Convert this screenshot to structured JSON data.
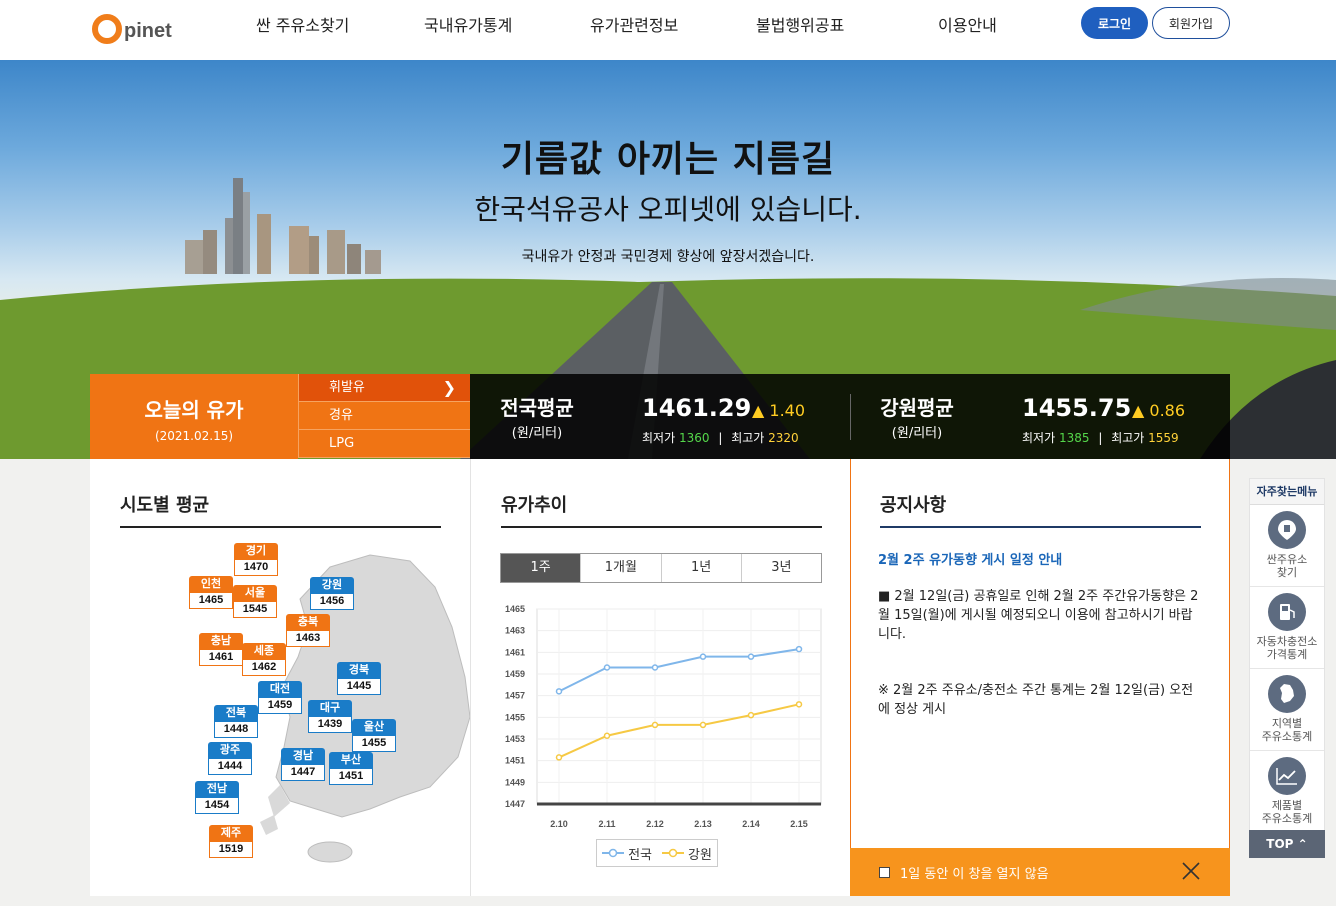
{
  "brand": {
    "logo_text": "pinet"
  },
  "nav": {
    "items": [
      "싼 주유소찾기",
      "국내유가통계",
      "유가관련정보",
      "불법행위공표",
      "이용안내"
    ],
    "login": "로그인",
    "join": "회원가입"
  },
  "hero": {
    "title": "기름값 아끼는 지름길",
    "subtitle": "한국석유공사 오피넷에 있습니다.",
    "desc": "국내유가 안정과 국민경제 향상에 앞장서겠습니다."
  },
  "today": {
    "title": "오늘의 유가",
    "date": "(2021.02.15)"
  },
  "fuel_tabs": [
    {
      "label": "휘발유",
      "active": true
    },
    {
      "label": "경유",
      "active": false
    },
    {
      "label": "LPG",
      "active": false
    }
  ],
  "price_summary": [
    {
      "name": "전국평균",
      "unit": "(원/리터)",
      "price": "1461.29",
      "delta": "▲ 1.40",
      "min_label": "최저가",
      "min": "1360",
      "max_label": "최고가",
      "max": "2320"
    },
    {
      "name": "강원평균",
      "unit": "(원/리터)",
      "price": "1455.75",
      "delta": "▲ 0.86",
      "min_label": "최저가",
      "min": "1385",
      "max_label": "최고가",
      "max": "1559"
    }
  ],
  "region_panel": {
    "title": "시도별 평균",
    "regions": [
      {
        "name": "경기",
        "value": "1470",
        "color": "orange"
      },
      {
        "name": "인천",
        "value": "1465",
        "color": "orange"
      },
      {
        "name": "서울",
        "value": "1545",
        "color": "orange"
      },
      {
        "name": "강원",
        "value": "1456",
        "color": "blue"
      },
      {
        "name": "충북",
        "value": "1463",
        "color": "orange"
      },
      {
        "name": "충남",
        "value": "1461",
        "color": "orange"
      },
      {
        "name": "세종",
        "value": "1462",
        "color": "orange"
      },
      {
        "name": "경북",
        "value": "1445",
        "color": "blue"
      },
      {
        "name": "대전",
        "value": "1459",
        "color": "blue"
      },
      {
        "name": "전북",
        "value": "1448",
        "color": "blue"
      },
      {
        "name": "대구",
        "value": "1439",
        "color": "blue"
      },
      {
        "name": "울산",
        "value": "1455",
        "color": "blue"
      },
      {
        "name": "광주",
        "value": "1444",
        "color": "blue"
      },
      {
        "name": "경남",
        "value": "1447",
        "color": "blue"
      },
      {
        "name": "부산",
        "value": "1451",
        "color": "blue"
      },
      {
        "name": "전남",
        "value": "1454",
        "color": "blue"
      },
      {
        "name": "제주",
        "value": "1519",
        "color": "orange"
      }
    ]
  },
  "trend_panel": {
    "title": "유가추이",
    "periods": [
      {
        "label": "1주",
        "active": true
      },
      {
        "label": "1개월",
        "active": false
      },
      {
        "label": "1년",
        "active": false
      },
      {
        "label": "3년",
        "active": false
      }
    ]
  },
  "chart_data": {
    "type": "line",
    "categories": [
      "2.10",
      "2.11",
      "2.12",
      "2.13",
      "2.14",
      "2.15"
    ],
    "y_ticks": [
      1447,
      1449,
      1451,
      1453,
      1455,
      1457,
      1459,
      1461,
      1463,
      1465
    ],
    "ylim": [
      1447,
      1465
    ],
    "series": [
      {
        "name": "전국",
        "color": "#7fb6ea",
        "values": [
          1457.4,
          1459.6,
          1459.6,
          1460.6,
          1460.6,
          1461.3
        ]
      },
      {
        "name": "강원",
        "color": "#f6c944",
        "values": [
          1451.3,
          1453.3,
          1454.3,
          1454.3,
          1455.2,
          1456.2
        ]
      }
    ],
    "grid": true,
    "legend": "bottom"
  },
  "notice": {
    "title": "공지사항",
    "headline": "2월 2주 유가동향 게시 일정 안내",
    "body": [
      "■ 2월 12일(금) 공휴일로 인해 2월 2주 주간유가동향은 2월 15일(월)에 게시될 예정되오니 이용에 참고하시기 바랍니다.",
      "※ 2월 2주 주유소/충전소 주간 통계는 2월 12일(금) 오전에 정상 게시"
    ],
    "dismiss": "1일 동안 이 창을 열지 않음"
  },
  "quick_menu": {
    "title": "자주찾는메뉴",
    "items": [
      {
        "label": "싼주유소\n찾기",
        "icon": "gas-pin-icon"
      },
      {
        "label": "자동차충전소\n가격통계",
        "icon": "charger-icon"
      },
      {
        "label": "지역별\n주유소통계",
        "icon": "korea-map-icon"
      },
      {
        "label": "제품별\n주유소통계",
        "icon": "line-chart-icon"
      }
    ],
    "top": "TOP"
  },
  "colors": {
    "accent": "#f07414",
    "blue": "#1a7cc8",
    "login": "#1f5fbf"
  }
}
